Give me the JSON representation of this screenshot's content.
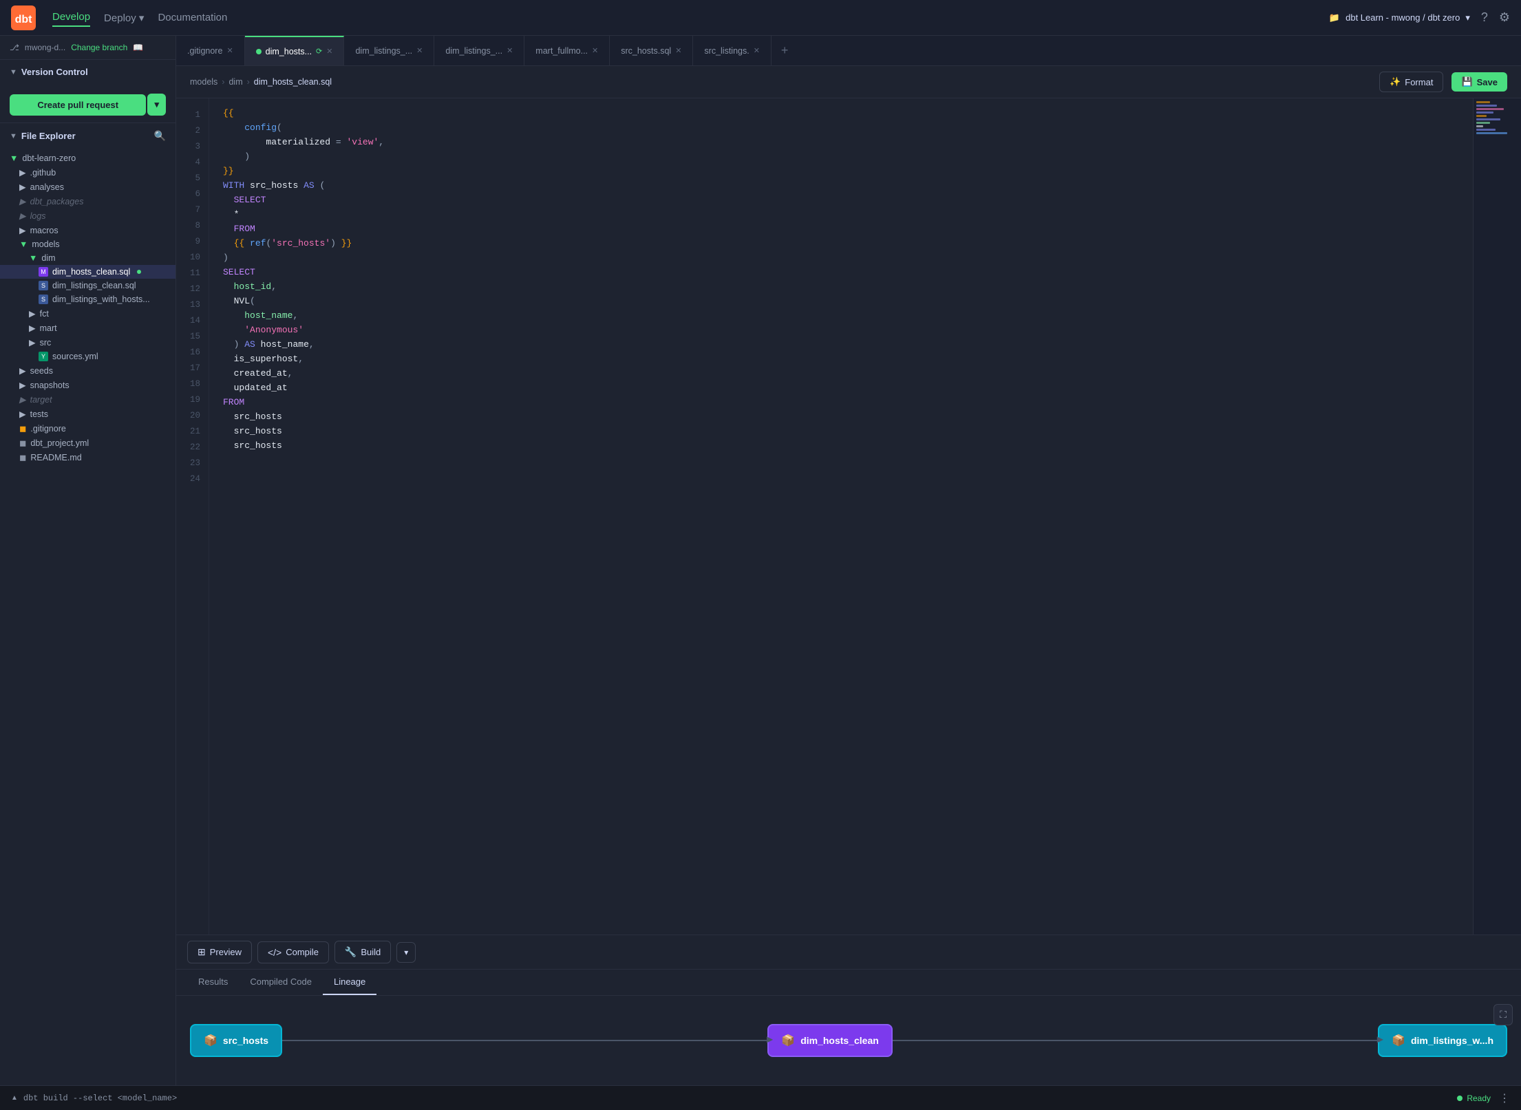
{
  "app": {
    "title": "dbt",
    "logo_text": "dbt"
  },
  "nav": {
    "links": [
      {
        "id": "develop",
        "label": "Develop",
        "active": true
      },
      {
        "id": "deploy",
        "label": "Deploy",
        "active": false,
        "has_dropdown": true
      },
      {
        "id": "documentation",
        "label": "Documentation",
        "active": false
      }
    ],
    "project": "dbt Learn - mwong / dbt zero",
    "help_label": "?",
    "settings_label": "⚙"
  },
  "sidebar": {
    "branch": {
      "icon": "branch-icon",
      "name": "mwong-d...",
      "change_label": "Change branch",
      "book_icon": "book-icon"
    },
    "version_control": {
      "title": "Version Control",
      "create_pr_label": "Create pull request"
    },
    "file_explorer": {
      "title": "File Explorer",
      "search_icon": "search-icon"
    },
    "tree": [
      {
        "id": "dbt-learn-zero",
        "label": "dbt-learn-zero",
        "type": "folder",
        "indent": 0,
        "open": true
      },
      {
        "id": "github",
        "label": ".github",
        "type": "folder",
        "indent": 1
      },
      {
        "id": "analyses",
        "label": "analyses",
        "type": "folder",
        "indent": 1
      },
      {
        "id": "dbt_packages",
        "label": "dbt_packages",
        "type": "folder",
        "indent": 1,
        "dimmed": true
      },
      {
        "id": "logs",
        "label": "logs",
        "type": "folder",
        "indent": 1,
        "dimmed": true
      },
      {
        "id": "macros",
        "label": "macros",
        "type": "folder",
        "indent": 1
      },
      {
        "id": "models",
        "label": "models",
        "type": "folder",
        "indent": 1,
        "open": true
      },
      {
        "id": "dim",
        "label": "dim",
        "type": "folder",
        "indent": 2,
        "open": true
      },
      {
        "id": "dim_hosts_clean",
        "label": "dim_hosts_clean.sql",
        "type": "model",
        "indent": 3,
        "active": true
      },
      {
        "id": "dim_listings_clean",
        "label": "dim_listings_clean.sql",
        "type": "sql",
        "indent": 3
      },
      {
        "id": "dim_listings_with_hosts",
        "label": "dim_listings_with_hosts...",
        "type": "sql",
        "indent": 3
      },
      {
        "id": "fct",
        "label": "fct",
        "type": "folder",
        "indent": 2
      },
      {
        "id": "mart",
        "label": "mart",
        "type": "folder",
        "indent": 2
      },
      {
        "id": "src",
        "label": "src",
        "type": "folder",
        "indent": 2
      },
      {
        "id": "sources_yml",
        "label": "sources.yml",
        "type": "yml",
        "indent": 3
      },
      {
        "id": "seeds",
        "label": "seeds",
        "type": "folder",
        "indent": 1
      },
      {
        "id": "snapshots",
        "label": "snapshots",
        "type": "folder",
        "indent": 1
      },
      {
        "id": "target",
        "label": "target",
        "type": "folder",
        "indent": 1,
        "dimmed": true
      },
      {
        "id": "tests",
        "label": "tests",
        "type": "folder",
        "indent": 1
      },
      {
        "id": "gitignore",
        "label": ".gitignore",
        "type": "file",
        "indent": 1
      },
      {
        "id": "dbt_project_yml",
        "label": "dbt_project.yml",
        "type": "file",
        "indent": 1
      },
      {
        "id": "readme",
        "label": "README.md",
        "type": "file",
        "indent": 1
      }
    ]
  },
  "editor": {
    "tabs": [
      {
        "id": "gitignore",
        "label": ".gitignore",
        "active": false
      },
      {
        "id": "dim_hosts",
        "label": "dim_hosts...",
        "active": true,
        "has_indicator": true
      },
      {
        "id": "dim_listings_1",
        "label": "dim_listings_...",
        "active": false
      },
      {
        "id": "dim_listings_2",
        "label": "dim_listings_...",
        "active": false
      },
      {
        "id": "mart_fullmo",
        "label": "mart_fullmo...",
        "active": false
      },
      {
        "id": "src_hosts",
        "label": "src_hosts.sql",
        "active": false
      },
      {
        "id": "src_listings",
        "label": "src_listings.",
        "active": false
      }
    ],
    "breadcrumb": {
      "items": [
        "models",
        "dim",
        "dim_hosts_clean.sql"
      ]
    },
    "format_label": "Format",
    "save_label": "Save",
    "code_lines": [
      {
        "num": 1,
        "code": "{{"
      },
      {
        "num": 2,
        "code": "    config("
      },
      {
        "num": 3,
        "code": "        materialized = 'view',"
      },
      {
        "num": 4,
        "code": "    )"
      },
      {
        "num": 5,
        "code": "}}"
      },
      {
        "num": 6,
        "code": "WITH src_hosts AS ("
      },
      {
        "num": 7,
        "code": "  SELECT"
      },
      {
        "num": 8,
        "code": "  *"
      },
      {
        "num": 9,
        "code": "  FROM"
      },
      {
        "num": 10,
        "code": "  {{ ref('src_hosts') }}"
      },
      {
        "num": 11,
        "code": ")"
      },
      {
        "num": 12,
        "code": "SELECT"
      },
      {
        "num": 13,
        "code": "  host_id,"
      },
      {
        "num": 14,
        "code": "  NVL("
      },
      {
        "num": 15,
        "code": "    host_name,"
      },
      {
        "num": 16,
        "code": "    'Anonymous'"
      },
      {
        "num": 17,
        "code": "  ) AS host_name,"
      },
      {
        "num": 18,
        "code": "  is_superhost,"
      },
      {
        "num": 19,
        "code": "  created_at,"
      },
      {
        "num": 20,
        "code": "  updated_at"
      },
      {
        "num": 21,
        "code": "FROM"
      },
      {
        "num": 22,
        "code": "  src_hosts"
      },
      {
        "num": 23,
        "code": "  src_hosts"
      },
      {
        "num": 24,
        "code": "  src_hosts"
      }
    ]
  },
  "bottom_panel": {
    "buttons": [
      {
        "id": "preview",
        "label": "Preview",
        "icon": "table-icon"
      },
      {
        "id": "compile",
        "label": "Compile",
        "icon": "code-icon"
      },
      {
        "id": "build",
        "label": "Build",
        "icon": "wrench-icon"
      }
    ],
    "tabs": [
      {
        "id": "results",
        "label": "Results",
        "active": false
      },
      {
        "id": "compiled_code",
        "label": "Compiled Code",
        "active": false
      },
      {
        "id": "lineage",
        "label": "Lineage",
        "active": true
      }
    ],
    "lineage_nodes": [
      {
        "id": "src_hosts",
        "label": "src_hosts",
        "type": "source"
      },
      {
        "id": "dim_hosts_clean",
        "label": "dim_hosts_clean",
        "type": "model-active"
      },
      {
        "id": "dim_listings_w",
        "label": "dim_listings_w...h",
        "type": "downstream"
      }
    ]
  },
  "status_bar": {
    "command": "dbt build --select <model_name>",
    "ready_label": "Ready",
    "chevron_icon": "chevron-up-icon",
    "menu_icon": "ellipsis-icon"
  },
  "colors": {
    "accent_green": "#4ade80",
    "brand_orange": "#f97316",
    "bg_dark": "#1a1f2e",
    "bg_sidebar": "#1e2330",
    "purple": "#7c3aed",
    "blue": "#0891b2"
  }
}
